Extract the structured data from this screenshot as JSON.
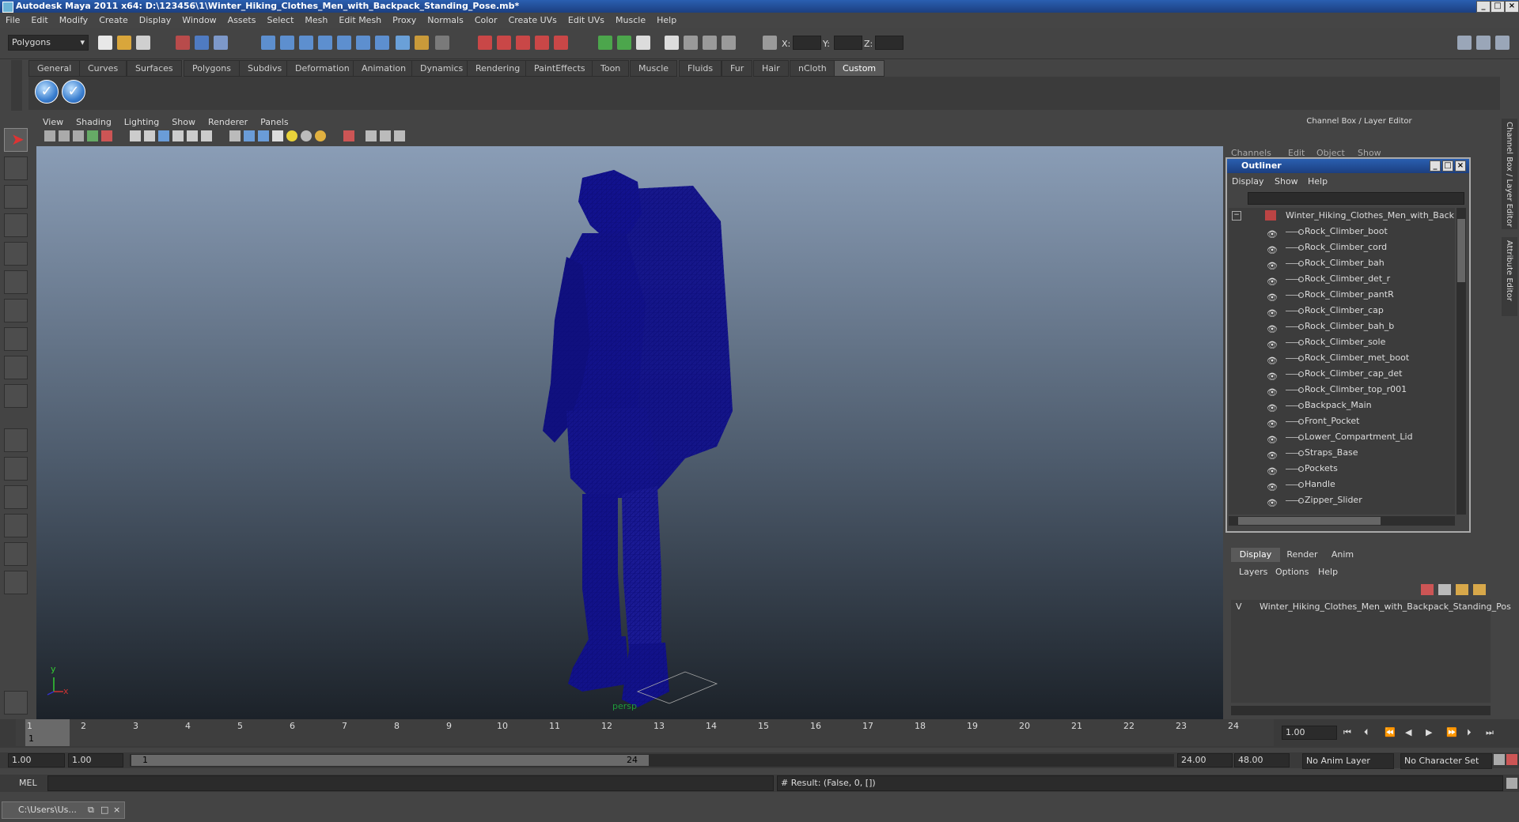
{
  "window": {
    "title": "Autodesk Maya 2011 x64: D:\\123456\\1\\Winter_Hiking_Clothes_Men_with_Backpack_Standing_Pose.mb*"
  },
  "menubar": [
    "File",
    "Edit",
    "Modify",
    "Create",
    "Display",
    "Window",
    "Assets",
    "Select",
    "Mesh",
    "Edit Mesh",
    "Proxy",
    "Normals",
    "Color",
    "Create UVs",
    "Edit UVs",
    "Muscle",
    "Help"
  ],
  "statusline": {
    "mode": "Polygons",
    "x_label": "X:",
    "y_label": "Y:",
    "z_label": "Z:"
  },
  "shelf_tabs": [
    "General",
    "Curves",
    "Surfaces",
    "Polygons",
    "Subdivs",
    "Deformation",
    "Animation",
    "Dynamics",
    "Rendering",
    "PaintEffects",
    "Toon",
    "Muscle",
    "Fluids",
    "Fur",
    "Hair",
    "nCloth",
    "Custom"
  ],
  "shelf_active": "Custom",
  "viewport": {
    "menu": [
      "View",
      "Shading",
      "Lighting",
      "Show",
      "Renderer",
      "Panels"
    ],
    "camera_label": "persp",
    "axis_x": "x",
    "axis_y": "y"
  },
  "channel_box": {
    "title": "Channel Box / Layer Editor",
    "menu": [
      "Channels",
      "Edit",
      "Object",
      "Show"
    ]
  },
  "side_tabs": [
    "Channel Box / Layer Editor",
    "Attribute Editor"
  ],
  "outliner": {
    "title": "Outliner",
    "menu": [
      "Display",
      "Show",
      "Help"
    ],
    "root": "Winter_Hiking_Clothes_Men_with_Backpack",
    "items": [
      "Rock_Climber_boot",
      "Rock_Climber_cord",
      "Rock_Climber_bah",
      "Rock_Climber_det_r",
      "Rock_Climber_pantR",
      "Rock_Climber_cap",
      "Rock_Climber_bah_b",
      "Rock_Climber_sole",
      "Rock_Climber_met_boot",
      "Rock_Climber_cap_det",
      "Rock_Climber_top_r001",
      "Backpack_Main",
      "Front_Pocket",
      "Lower_Compartment_Lid",
      "Straps_Base",
      "Pockets",
      "Handle",
      "Zipper_Slider"
    ]
  },
  "layer_editor": {
    "tabs": [
      "Display",
      "Render",
      "Anim"
    ],
    "active_tab": "Display",
    "menu": [
      "Layers",
      "Options",
      "Help"
    ],
    "layer_visible": "V",
    "layer_name": "Winter_Hiking_Clothes_Men_with_Backpack_Standing_Pos"
  },
  "timeline": {
    "ticks": [
      "1",
      "2",
      "3",
      "4",
      "5",
      "6",
      "7",
      "8",
      "9",
      "10",
      "11",
      "12",
      "13",
      "14",
      "15",
      "16",
      "17",
      "18",
      "19",
      "20",
      "21",
      "22",
      "23",
      "24"
    ],
    "current_frame": "1",
    "current_time": "1.00"
  },
  "range": {
    "start": "1.00",
    "playback_start": "1.00",
    "slider_start": "1",
    "slider_end": "24",
    "playback_end": "24.00",
    "end": "48.00",
    "anim_layer": "No Anim Layer",
    "char_set": "No Character Set"
  },
  "cmdline": {
    "label": "MEL",
    "result": "# Result: (False, 0, [])"
  },
  "taskbar": {
    "item": "C:\\Users\\Us..."
  }
}
